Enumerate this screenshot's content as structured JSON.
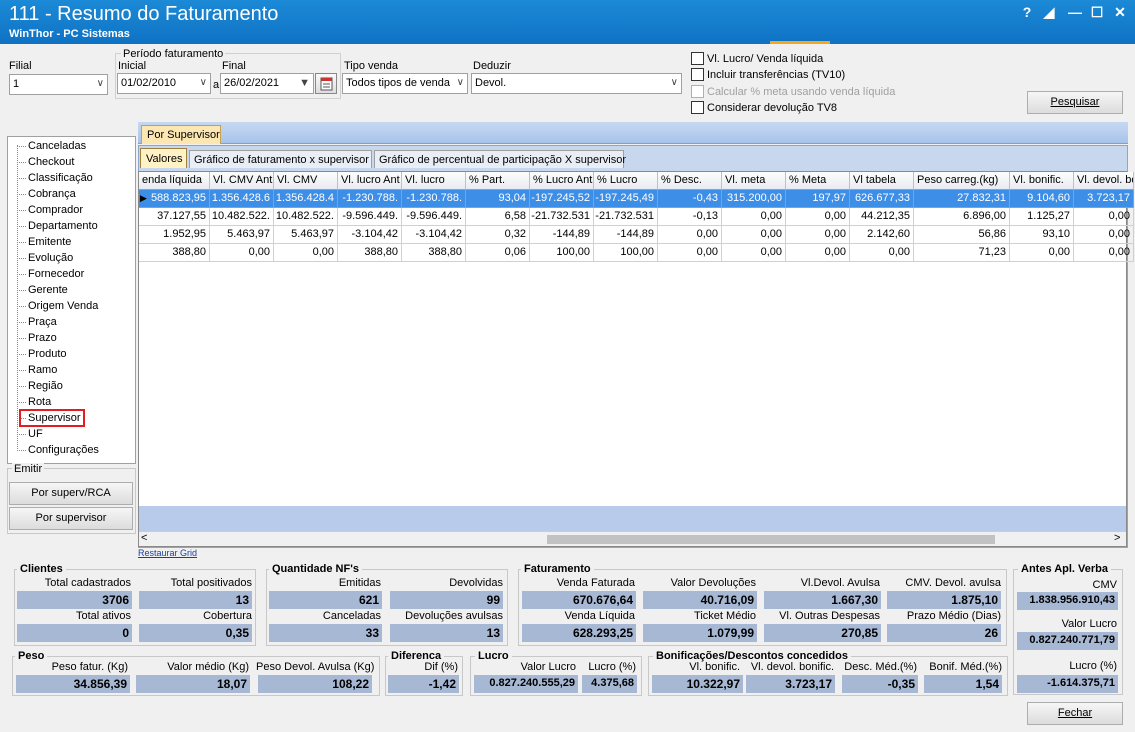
{
  "window": {
    "title": "111 - Resumo do Faturamento",
    "subtitle": "WinThor - PC Sistemas",
    "controls": [
      "?",
      "◢",
      "—",
      "☐",
      "✕"
    ]
  },
  "filters": {
    "filial_label": "Filial",
    "filial_value": "1",
    "periodo_label": "Período faturamento",
    "inicial_label": "Inicial",
    "inicial_value": "01/02/2010",
    "sep": "a",
    "final_label": "Final",
    "final_value": "26/02/2021",
    "tipo_venda_label": "Tipo venda",
    "tipo_venda_value": "Todos tipos de venda",
    "deduzir_label": "Deduzir",
    "deduzir_value": "Devol."
  },
  "options": [
    {
      "label": "Vl. Lucro/ Venda líquida",
      "enabled": true
    },
    {
      "label": "Incluir transferências  (TV10)",
      "enabled": true
    },
    {
      "label": "Calcular % meta usando venda líquida",
      "enabled": false
    },
    {
      "label": "Considerar devolução TV8",
      "enabled": true
    }
  ],
  "pesquisar_label": "Pesquisar",
  "tree": {
    "items": [
      "Canceladas",
      "Checkout",
      "Classificação",
      "Cobrança",
      "Comprador",
      "Departamento",
      "Emitente",
      "Evolução",
      "Fornecedor",
      "Gerente",
      "Origem Venda",
      "Praça",
      "Prazo",
      "Produto",
      "Ramo",
      "Região",
      "Rota",
      "Supervisor",
      "UF",
      "Configurações"
    ],
    "selected": "Supervisor"
  },
  "emitir": {
    "label": "Emitir",
    "buttons": [
      "Por superv/RCA",
      "Por supervisor"
    ]
  },
  "main_tab": "Por Supervisor",
  "sub_tabs": [
    "Valores",
    "Gráfico de faturamento x supervisor",
    "Gráfico de percentual de participação X supervisor"
  ],
  "grid": {
    "columns": [
      "enda líquida",
      "Vl. CMV Ant",
      "Vl. CMV",
      "Vl. lucro Ant",
      "Vl. lucro",
      "% Part.",
      "% Lucro Ant",
      "% Lucro",
      "% Desc.",
      "Vl. meta",
      "% Meta",
      "Vl tabela",
      "Peso carreg.(kg)",
      "Vl. bonific.",
      "Vl. devol. bo"
    ],
    "rows": [
      [
        "588.823,95",
        "1.356.428.6",
        "1.356.428.4",
        "-1.230.788.",
        "-1.230.788.",
        "93,04",
        "-197.245,52",
        "-197.245,49",
        "-0,43",
        "315.200,00",
        "197,97",
        "626.677,33",
        "27.832,31",
        "9.104,60",
        "3.723,17"
      ],
      [
        "37.127,55",
        "10.482.522.",
        "10.482.522.",
        "-9.596.449.",
        "-9.596.449.",
        "6,58",
        "-21.732.531",
        "-21.732.531",
        "-0,13",
        "0,00",
        "0,00",
        "44.212,35",
        "6.896,00",
        "1.125,27",
        "0,00"
      ],
      [
        "1.952,95",
        "5.463,97",
        "5.463,97",
        "-3.104,42",
        "-3.104,42",
        "0,32",
        "-144,89",
        "-144,89",
        "0,00",
        "0,00",
        "0,00",
        "2.142,60",
        "56,86",
        "93,10",
        "0,00"
      ],
      [
        "388,80",
        "0,00",
        "0,00",
        "388,80",
        "388,80",
        "0,06",
        "100,00",
        "100,00",
        "0,00",
        "0,00",
        "0,00",
        "0,00",
        "71,23",
        "0,00",
        "0,00"
      ]
    ],
    "restaurar": "Restaurar Grid"
  },
  "summary": {
    "clientes": {
      "title": "Clientes",
      "total_cadastrados_label": "Total cadastrados",
      "total_cadastrados": "3706",
      "total_positivados_label": "Total positivados",
      "total_positivados": "13",
      "total_ativos_label": "Total ativos",
      "total_ativos": "0",
      "cobertura_label": "Cobertura",
      "cobertura": "0,35"
    },
    "nfs": {
      "title": "Quantidade NF's",
      "emitidas_label": "Emitidas",
      "emitidas": "621",
      "devolvidas_label": "Devolvidas",
      "devolvidas": "99",
      "canceladas_label": "Canceladas",
      "canceladas": "33",
      "devol_avulsas_label": "Devoluções avulsas",
      "devol_avulsas": "13"
    },
    "faturamento": {
      "title": "Faturamento",
      "venda_faturada_label": "Venda Faturada",
      "venda_faturada": "670.676,64",
      "valor_devol_label": "Valor Devoluções",
      "valor_devol": "40.716,09",
      "vl_devol_avulsa_label": "Vl.Devol. Avulsa",
      "vl_devol_avulsa": "1.667,30",
      "cmv_devol_label": "CMV. Devol. avulsa",
      "cmv_devol": "1.875,10",
      "venda_liquida_label": "Venda Líquida",
      "venda_liquida": "628.293,25",
      "ticket_label": "Ticket Médio",
      "ticket": "1.079,99",
      "outras_despesas_label": "Vl. Outras Despesas",
      "outras_despesas": "270,85",
      "prazo_label": "Prazo Médio (Dias)",
      "prazo": "26"
    },
    "antes": {
      "title": "Antes Apl. Verba",
      "cmv_label": "CMV",
      "cmv": "1.838.956.910,43",
      "valor_lucro_label": "Valor Lucro",
      "valor_lucro": "0.827.240.771,79",
      "lucro_pct_label": "Lucro (%)",
      "lucro_pct": "-1.614.375,71"
    },
    "peso": {
      "title": "Peso",
      "peso_fatur_label": "Peso fatur. (Kg)",
      "peso_fatur": "34.856,39",
      "valor_medio_label": "Valor médio (Kg)",
      "valor_medio": "18,07",
      "peso_devol_label": "Peso Devol. Avulsa (Kg)",
      "peso_devol": "108,22"
    },
    "diferenca": {
      "title": "Diferenca",
      "dif_label": "Dif (%)",
      "dif": "-1,42"
    },
    "lucro": {
      "title": "Lucro",
      "valor_label": "Valor Lucro",
      "valor": "0.827.240.555,29",
      "pct_label": "Lucro (%)",
      "pct": "4.375,68"
    },
    "bonif": {
      "title": "Bonificações/Descontos concedidos",
      "vl_bonific_label": "Vl. bonific.",
      "vl_bonific": "10.322,97",
      "vl_devol_bonific_label": "Vl. devol. bonific.",
      "vl_devol_bonific": "3.723,17",
      "desc_med_label": "Desc. Méd.(%)",
      "desc_med": "-0,35",
      "bonif_med_label": "Bonif. Méd.(%)",
      "bonif_med": "1,54"
    }
  },
  "fechar_label": "Fechar"
}
